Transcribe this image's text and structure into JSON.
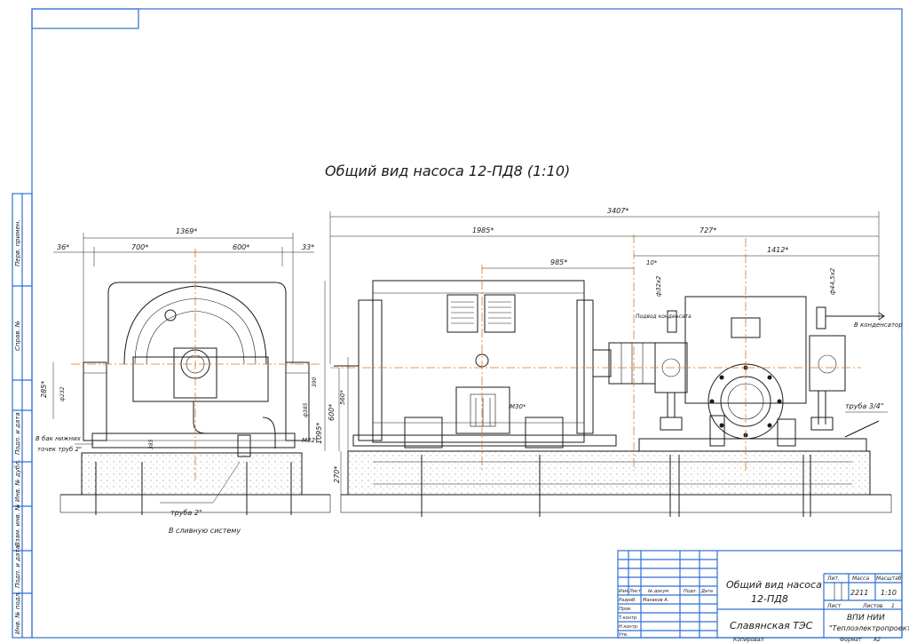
{
  "title": "Общий вид насоса 12-ПД8 (1:10)",
  "colors": {
    "frame": "#2d6fd6",
    "axis": "#e0781a",
    "ink": "#1a1a1a"
  },
  "dimensions": {
    "d1369": "1369*",
    "d36": "36*",
    "d700": "700*",
    "d600": "600*",
    "d33": "33*",
    "d3407": "3407*",
    "d1985": "1985*",
    "d727": "727*",
    "d1412": "1412*",
    "d985": "985*",
    "d10": "10*",
    "d285": "285*",
    "d600v": "600*",
    "d560": "560*",
    "d1095": "1095*",
    "d270": "270*",
    "d_phi32": "ф32х2",
    "d_phi44": "ф44,5х2",
    "m30": "М30*",
    "m32": "М32*",
    "small_d1": "ф232",
    "small_d2": "ф385",
    "small_d3": "385",
    "small_d4": "390"
  },
  "notes": {
    "pipe2": "труба 2\"",
    "to_drain": "В сливную систему",
    "pipe34": "труба 3/4\"",
    "to_condenser": "В конденсатор",
    "from_condensate": "Подвод конденсата",
    "from_collector_1": "В бак нижних",
    "from_collector_2": "точек труб 2\""
  },
  "side_stamp": [
    "Перв. примен.",
    "Справ. №",
    "Подп. и дата",
    "Инв. № дубл.",
    "Взам. инв. №",
    "Подп. и дата",
    "Инв. № подл."
  ],
  "title_block": {
    "drawing_name_1": "Общий вид насоса",
    "drawing_name_2": "12-ПД8",
    "object": "Славянская ТЭС",
    "org_1": "ВПИ НИИ",
    "org_2": "\"Теплоэлектропроект\"",
    "mass_label": "Масса",
    "mass_value": "2211",
    "scale_label": "Масштаб",
    "scale_value": "1:10",
    "lit_label": "Лит.",
    "sheet_label": "Лист",
    "sheets_label": "Листов",
    "sheets_value": "1",
    "copy_label": "Копировал",
    "format_label": "Формат",
    "format_value": "А2",
    "rows": [
      {
        "role": "Изм.",
        "col2": "Лист",
        "col3": "№ докум.",
        "col4": "Подп.",
        "col5": "Дата"
      },
      {
        "role": "Разраб.",
        "col2": "",
        "col3": "Манаков А.",
        "col4": "",
        "col5": ""
      },
      {
        "role": "Пров.",
        "col2": "",
        "col3": "",
        "col4": "",
        "col5": ""
      },
      {
        "role": "Т.контр.",
        "col2": "",
        "col3": "",
        "col4": "",
        "col5": ""
      },
      {
        "role": "Н.контр.",
        "col2": "",
        "col3": "",
        "col4": "",
        "col5": ""
      },
      {
        "role": "Утв.",
        "col2": "",
        "col3": "",
        "col4": "",
        "col5": ""
      }
    ]
  }
}
